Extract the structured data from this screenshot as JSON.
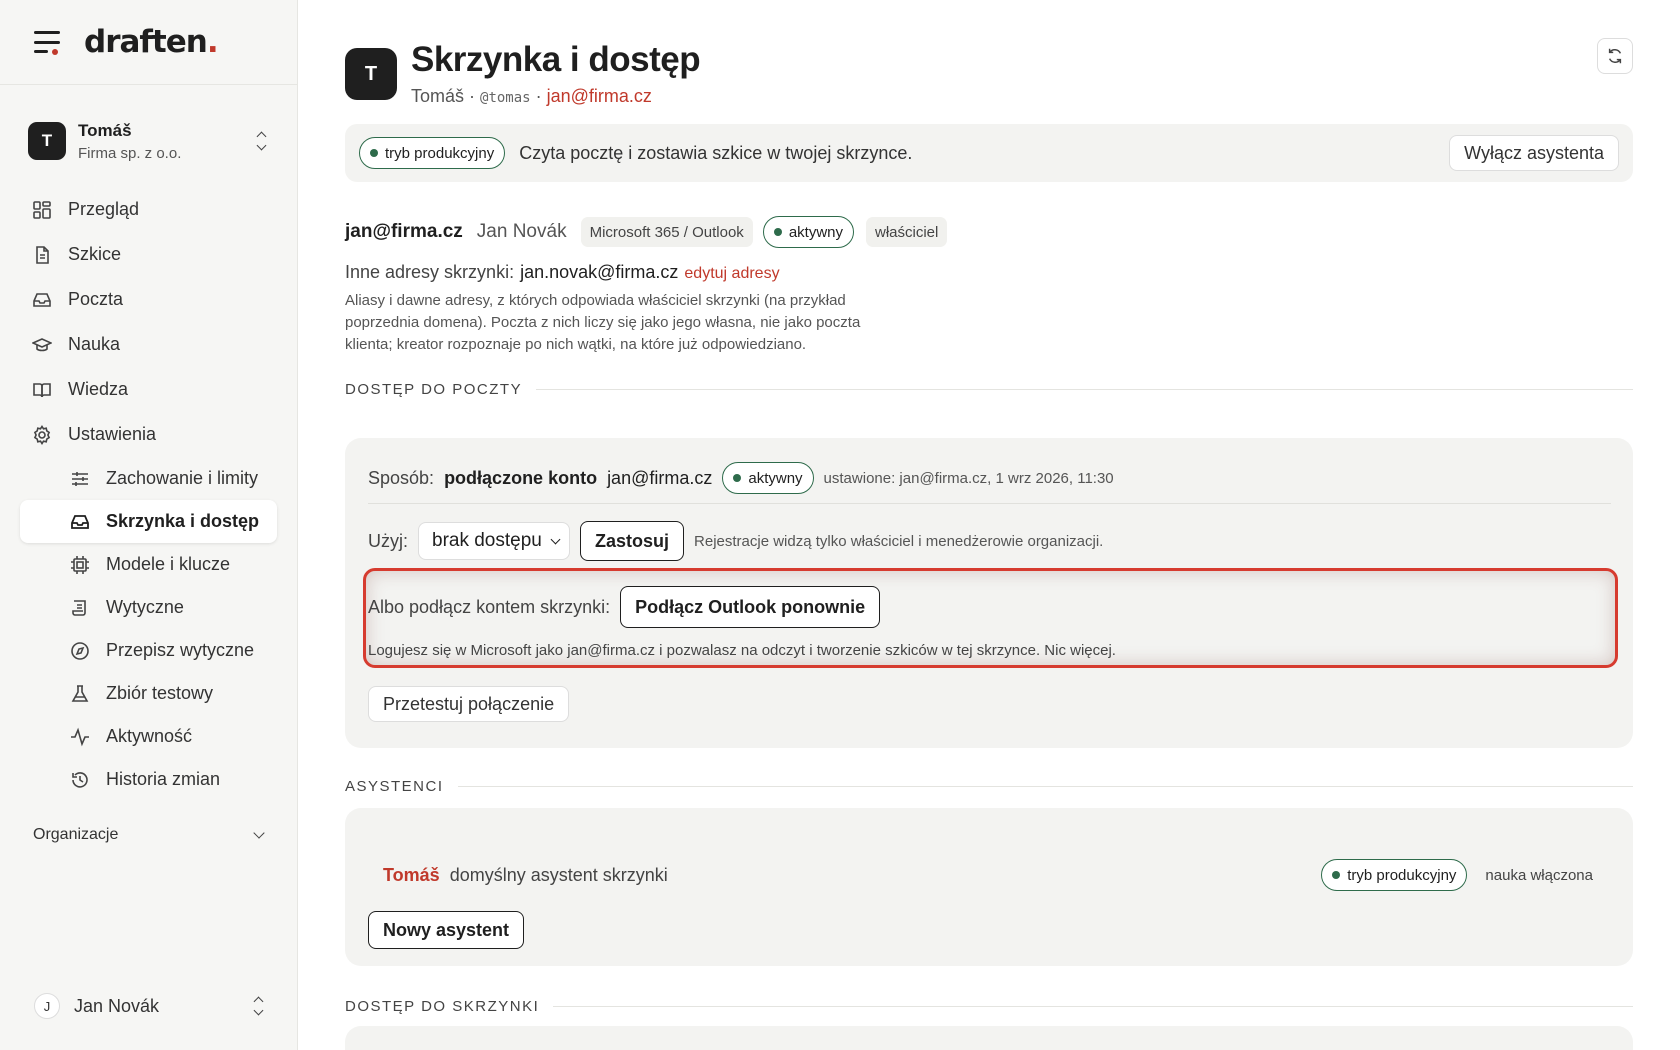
{
  "brand": {
    "logo": "draften",
    "logo_dot": "."
  },
  "account": {
    "initial": "T",
    "name": "Tomáš",
    "org": "Firma sp. z o.o."
  },
  "nav": {
    "items": [
      {
        "label": "Przegląd",
        "icon": "grid-icon"
      },
      {
        "label": "Szkice",
        "icon": "document-icon"
      },
      {
        "label": "Poczta",
        "icon": "inbox-icon"
      },
      {
        "label": "Nauka",
        "icon": "graduation-cap-icon"
      },
      {
        "label": "Wiedza",
        "icon": "book-icon"
      },
      {
        "label": "Ustawienia",
        "icon": "gear-icon"
      }
    ],
    "sub_items": [
      {
        "label": "Zachowanie i limity",
        "icon": "sliders-icon"
      },
      {
        "label": "Skrzynka i dostęp",
        "icon": "inbox-icon",
        "active": true
      },
      {
        "label": "Modele i klucze",
        "icon": "chip-icon"
      },
      {
        "label": "Wytyczne",
        "icon": "scroll-icon"
      },
      {
        "label": "Przepisz wytyczne",
        "icon": "compass-icon"
      },
      {
        "label": "Zbiór testowy",
        "icon": "flask-icon"
      },
      {
        "label": "Aktywność",
        "icon": "activity-icon"
      },
      {
        "label": "Historia zmian",
        "icon": "history-icon"
      }
    ],
    "org_label": "Organizacje"
  },
  "user": {
    "initial": "J",
    "name": "Jan Novák"
  },
  "page": {
    "initial": "T",
    "title": "Skrzynka i dostęp",
    "sub_name": "Tomáš",
    "sub_sep": " · ",
    "handle": "@tomas",
    "email": "jan@firma.cz"
  },
  "banner": {
    "pill": "tryb produkcyjny",
    "text": "Czyta pocztę i zostawia szkice w twojej skrzynce.",
    "button": "Wyłącz asystenta"
  },
  "owner": {
    "email": "jan@firma.cz",
    "name": "Jan Novák",
    "provider": "Microsoft 365 / Outlook",
    "status": "aktywny",
    "role": "właściciel"
  },
  "aliases": {
    "label": "Inne adresy skrzynki:",
    "value": "jan.novak@firma.cz",
    "link": "edytuj adresy",
    "description": "Aliasy i dawne adresy, z których odpowiada właściciel skrzynki (na przykład poprzednia domena). Poczta z nich liczy się jako jego własna, nie jako poczta klienta; kreator rozpoznaje po nich wątki, na które już odpowiedziano."
  },
  "mail_access": {
    "section": "DOSTĘP DO POCZTY",
    "method_label": "Sposób:",
    "method": "podłączone konto",
    "account": "jan@firma.cz",
    "status": "aktywny",
    "meta": "ustawione: jan@firma.cz, 1 wrz 2026, 11:30",
    "use_label": "Użyj:",
    "select_value": "brak dostępu",
    "apply_button": "Zastosuj",
    "apply_note": "Rejestracje widzą tylko właściciel i menedżerowie organizacji.",
    "connect_label": "Albo podłącz kontem skrzynki:",
    "connect_button": "Podłącz Outlook ponownie",
    "connect_note": "Logujesz się w Microsoft jako jan@firma.cz i pozwalasz na odczyt i tworzenie szkiców w tej skrzynce. Nic więcej.",
    "test_button": "Przetestuj połączenie"
  },
  "assistants": {
    "section": "ASYSTENCI",
    "name": "Tomáš",
    "desc": "domyślny asystent skrzynki",
    "status": "tryb produkcyjny",
    "note": "nauka włączona",
    "new_button": "Nowy asystent"
  },
  "mailbox_access": {
    "section": "DOSTĘP DO SKRZYNKI"
  },
  "colors": {
    "accent": "#c0392b",
    "status_green": "#2e6b4b",
    "highlight": "#d63b2f"
  }
}
